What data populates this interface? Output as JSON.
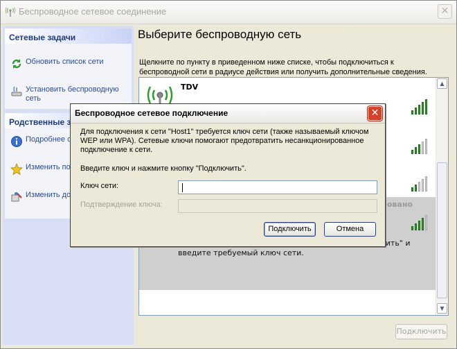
{
  "window": {
    "title": "Беспроводное сетевое соединение",
    "close": "✕"
  },
  "sidebar": {
    "network_tasks": {
      "header": "Сетевые задачи",
      "items": [
        {
          "label": "Обновить список сети",
          "icon": "refresh-icon"
        },
        {
          "label": "Установить беспроводную сеть",
          "icon": "wireless-setup-icon"
        }
      ]
    },
    "related_tasks": {
      "header": "Родственные з",
      "items": [
        {
          "label": "Подробнее о сетях",
          "icon": "info-icon"
        },
        {
          "label": "Изменить пор предпочтени",
          "icon": "star-icon"
        },
        {
          "label": "Изменить доп параметры",
          "icon": "settings-icon"
        }
      ]
    }
  },
  "main": {
    "title": "Выберите беспроводную сеть",
    "description": "Щелкните по пункту в приведенном ниже списке, чтобы подключиться к беспроводной сети в радиусе действия или получить дополнительные сведения.",
    "networks": [
      {
        "name": "TDV",
        "icon": "wireless-antenna-icon"
      }
    ],
    "selected_hint_tail": "ючить\" и",
    "selected_hint_line2": "введите требуемый ключ сети.",
    "selected_partial_label": "ровано",
    "connect_button": "Подключить"
  },
  "dialog": {
    "title": "Беспроводное сетевое подключение",
    "close": "✕",
    "message": "Для подключения к сети \"Host1\" требуется ключ сети (также называемый ключом WEP или WPA). Сетевые ключи помогают предотвратить несанкционированное подключение к сети.",
    "instruction": "Введите ключ и нажмите кнопку \"Подключить\".",
    "key_label": "Ключ сети:",
    "confirm_label": "Подтверждение ключа:",
    "connect_button": "Подключить",
    "cancel_button": "Отмена"
  },
  "colors": {
    "signal": "#2e9b2b",
    "dialog_close": "#d7412a",
    "task_link": "#2d4a8c"
  }
}
